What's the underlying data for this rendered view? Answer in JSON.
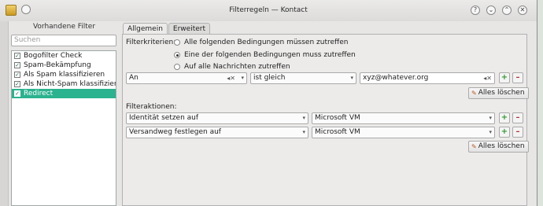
{
  "window": {
    "title": "Filterregeln — Kontact"
  },
  "left": {
    "heading": "Vorhandene Filter",
    "search_placeholder": "Suchen",
    "filters": [
      {
        "label": "Bogofilter Check",
        "checked": true,
        "selected": false
      },
      {
        "label": "Spam-Bekämpfung",
        "checked": true,
        "selected": false
      },
      {
        "label": "Als Spam klassifizieren",
        "checked": true,
        "selected": false
      },
      {
        "label": "Als Nicht-Spam klassifizieren",
        "checked": true,
        "selected": false
      },
      {
        "label": "Redirect",
        "checked": true,
        "selected": true
      }
    ]
  },
  "tabs": [
    "Allgemein",
    "Erweitert"
  ],
  "criteria": {
    "label": "Filterkriterien:",
    "options": [
      {
        "label": "Alle folgenden Bedingungen müssen zutreffen",
        "selected": false
      },
      {
        "label": "Eine der folgenden Bedingungen muss zutreffen",
        "selected": true
      },
      {
        "label": "Auf alle Nachrichten zutreffen",
        "selected": false
      }
    ],
    "rule": {
      "field": "An",
      "operator": "ist gleich",
      "value": "xyz@whatever.org"
    },
    "clear_label": "Alles löschen"
  },
  "actions": {
    "label": "Filteraktionen:",
    "rows": [
      {
        "action": "Identität setzen auf",
        "value": "Microsoft VM"
      },
      {
        "action": "Versandweg festlegen auf",
        "value": "Microsoft VM"
      }
    ],
    "clear_label": "Alles löschen"
  },
  "colors": {
    "accent": "#2bb28f",
    "plus": "#2e9a2e",
    "minus": "#b82e2e"
  },
  "icons": {
    "add": "plus-icon",
    "remove": "minus-icon",
    "clear": "broom-icon",
    "close": "close-icon"
  }
}
